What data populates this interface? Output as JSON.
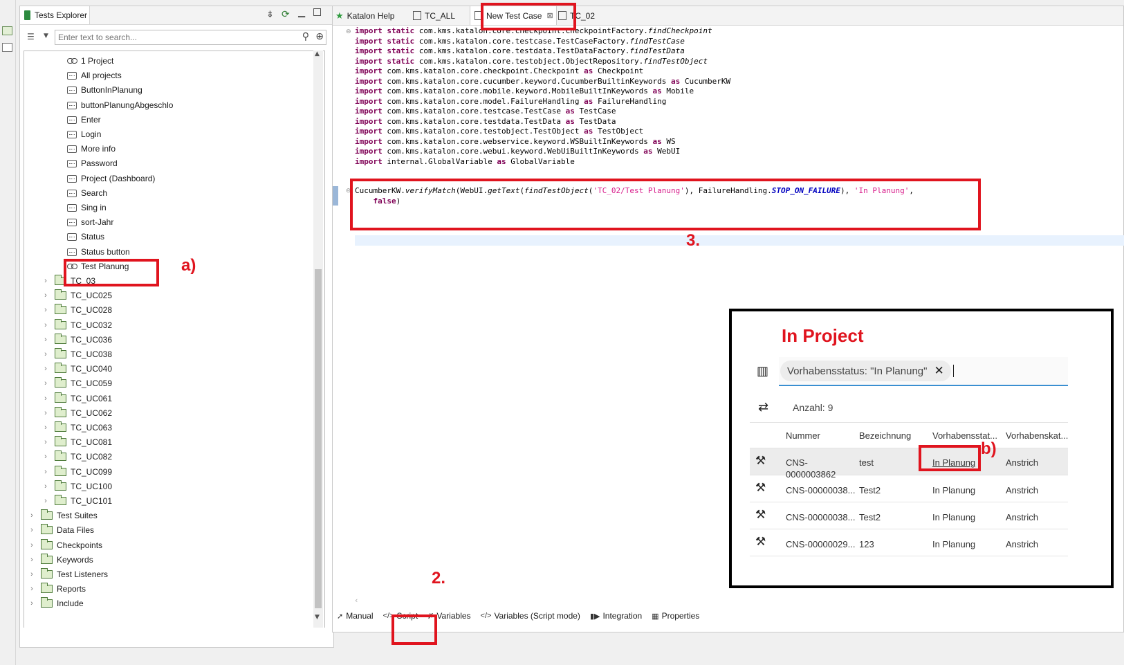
{
  "explorer": {
    "tab_label": "Tests Explorer",
    "search_placeholder": "Enter text to search...",
    "objects": [
      "1 Project",
      "All projects",
      "ButtonInPlanung",
      "buttonPlanungAbgeschlo",
      "Enter",
      "Login",
      "More info",
      "Password",
      "Project (Dashboard)",
      "Search",
      "Sing in",
      "sort-Jahr",
      "Status",
      "Status button",
      "Test Planung"
    ],
    "folders": [
      "TC_03",
      "TC_UC025",
      "TC_UC028",
      "TC_UC032",
      "TC_UC036",
      "TC_UC038",
      "TC_UC040",
      "TC_UC059",
      "TC_UC061",
      "TC_UC062",
      "TC_UC063",
      "TC_UC081",
      "TC_UC082",
      "TC_UC099",
      "TC_UC100",
      "TC_UC101"
    ],
    "roots": [
      "Test Suites",
      "Data Files",
      "Checkpoints",
      "Keywords",
      "Test Listeners",
      "Reports",
      "Include"
    ]
  },
  "editor": {
    "tabs": [
      "Katalon Help",
      "TC_ALL",
      "New Test Case",
      "TC_02"
    ],
    "imports": [
      {
        "kw": "import static",
        "body": "com.kms.katalon.core.checkpoint.CheckpointFactory.",
        "it": "findCheckpoint",
        "alias": ""
      },
      {
        "kw": "import static",
        "body": "com.kms.katalon.core.testcase.TestCaseFactory.",
        "it": "findTestCase",
        "alias": ""
      },
      {
        "kw": "import static",
        "body": "com.kms.katalon.core.testdata.TestDataFactory.",
        "it": "findTestData",
        "alias": ""
      },
      {
        "kw": "import static",
        "body": "com.kms.katalon.core.testobject.ObjectRepository.",
        "it": "findTestObject",
        "alias": ""
      },
      {
        "kw": "import",
        "body": "com.kms.katalon.core.checkpoint.Checkpoint",
        "it": "",
        "alias": "Checkpoint"
      },
      {
        "kw": "import",
        "body": "com.kms.katalon.core.cucumber.keyword.CucumberBuiltinKeywords",
        "it": "",
        "alias": "CucumberKW"
      },
      {
        "kw": "import",
        "body": "com.kms.katalon.core.mobile.keyword.MobileBuiltInKeywords",
        "it": "",
        "alias": "Mobile"
      },
      {
        "kw": "import",
        "body": "com.kms.katalon.core.model.FailureHandling",
        "it": "",
        "alias": "FailureHandling"
      },
      {
        "kw": "import",
        "body": "com.kms.katalon.core.testcase.TestCase",
        "it": "",
        "alias": "TestCase"
      },
      {
        "kw": "import",
        "body": "com.kms.katalon.core.testdata.TestData",
        "it": "",
        "alias": "TestData"
      },
      {
        "kw": "import",
        "body": "com.kms.katalon.core.testobject.TestObject",
        "it": "",
        "alias": "TestObject"
      },
      {
        "kw": "import",
        "body": "com.kms.katalon.core.webservice.keyword.WSBuiltInKeywords",
        "it": "",
        "alias": "WS"
      },
      {
        "kw": "import",
        "body": "com.kms.katalon.core.webui.keyword.WebUiBuiltInKeywords",
        "it": "",
        "alias": "WebUI"
      },
      {
        "kw": "import",
        "body": "internal.GlobalVariable",
        "it": "",
        "alias": "GlobalVariable"
      }
    ],
    "as_kw": "as",
    "stmt": {
      "p1": "CucumberKW.",
      "m1": "verifyMatch",
      "p2": "(WebUI.",
      "m2": "getText",
      "p3": "(",
      "m3": "findTestObject",
      "p4": "(",
      "s1": "'TC_02/Test Planung'",
      "p5": "), FailureHandling.",
      "c1": "STOP_ON_FAILURE",
      "p6": "), ",
      "s2": "'In Planung'",
      "p7": ",",
      "k1": "false",
      "p8": ")"
    },
    "bottom_tabs": [
      "Manual",
      "Script",
      "Variables",
      "Variables (Script mode)",
      "Integration",
      "Properties"
    ]
  },
  "annotations": {
    "a": "a)",
    "b": "b)",
    "two": "2.",
    "three": "3."
  },
  "inset": {
    "title": "In Project",
    "filter_chip": "Vorhabensstatus: \"In Planung\"",
    "count": "Anzahl: 9",
    "headers": [
      "Nummer",
      "Bezeichnung",
      "Vorhabensstat...",
      "Vorhabenskat..."
    ],
    "rows": [
      {
        "num": "CNS-\n0000003862",
        "name": "test",
        "status": "In Planung",
        "cat": "Anstrich"
      },
      {
        "num": "CNS-00000038...",
        "name": "Test2",
        "status": "In Planung",
        "cat": "Anstrich"
      },
      {
        "num": "CNS-00000038...",
        "name": "Test2",
        "status": "In Planung",
        "cat": "Anstrich"
      },
      {
        "num": "CNS-00000029...",
        "name": "123",
        "status": "In Planung",
        "cat": "Anstrich"
      }
    ]
  }
}
